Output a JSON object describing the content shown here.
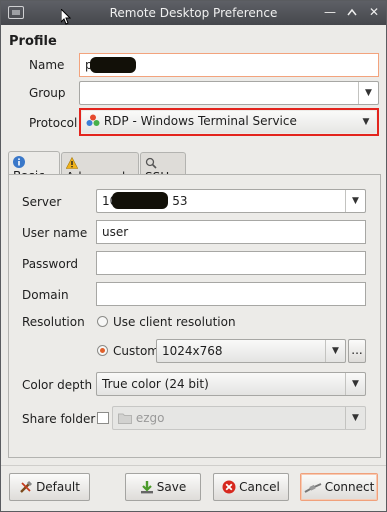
{
  "window": {
    "title": "Remote Desktop Preference"
  },
  "titlebar_icons": [
    "app-icon",
    "minimize-icon",
    "maximize-icon",
    "close-icon"
  ],
  "profile": {
    "heading": "Profile",
    "name_label": "Name",
    "name_value": "p",
    "group_label": "Group",
    "group_value": "",
    "protocol_label": "Protocol",
    "protocol_value": "RDP - Windows Terminal Service"
  },
  "tabs": [
    {
      "label": "Basic",
      "icon": "info-icon",
      "active": true
    },
    {
      "label": "Advanced",
      "icon": "warning-icon",
      "active": false
    },
    {
      "label": "SSH",
      "icon": "ssh-icon",
      "active": false
    }
  ],
  "basic": {
    "server_label": "Server",
    "server_prefix": "10",
    "server_suffix": "53",
    "username_label": "User name",
    "username_value": "user",
    "password_label": "Password",
    "password_value": "",
    "domain_label": "Domain",
    "domain_value": "",
    "resolution_label": "Resolution",
    "resolution_option_client": "Use client resolution",
    "resolution_option_custom": "Custom",
    "resolution_selected": "Custom",
    "resolution_value": "1024x768",
    "resolution_more": "...",
    "color_depth_label": "Color depth",
    "color_depth_value": "True color (24 bit)",
    "share_folder_label": "Share folder",
    "share_folder_checked": false,
    "share_folder_value": "ezgo"
  },
  "buttons": {
    "default": "Default",
    "save": "Save",
    "cancel": "Cancel",
    "connect": "Connect"
  },
  "colors": {
    "highlight_box": "#e3241d",
    "focus_border": "#f3a37d",
    "radio_selected": "#e0602b"
  }
}
